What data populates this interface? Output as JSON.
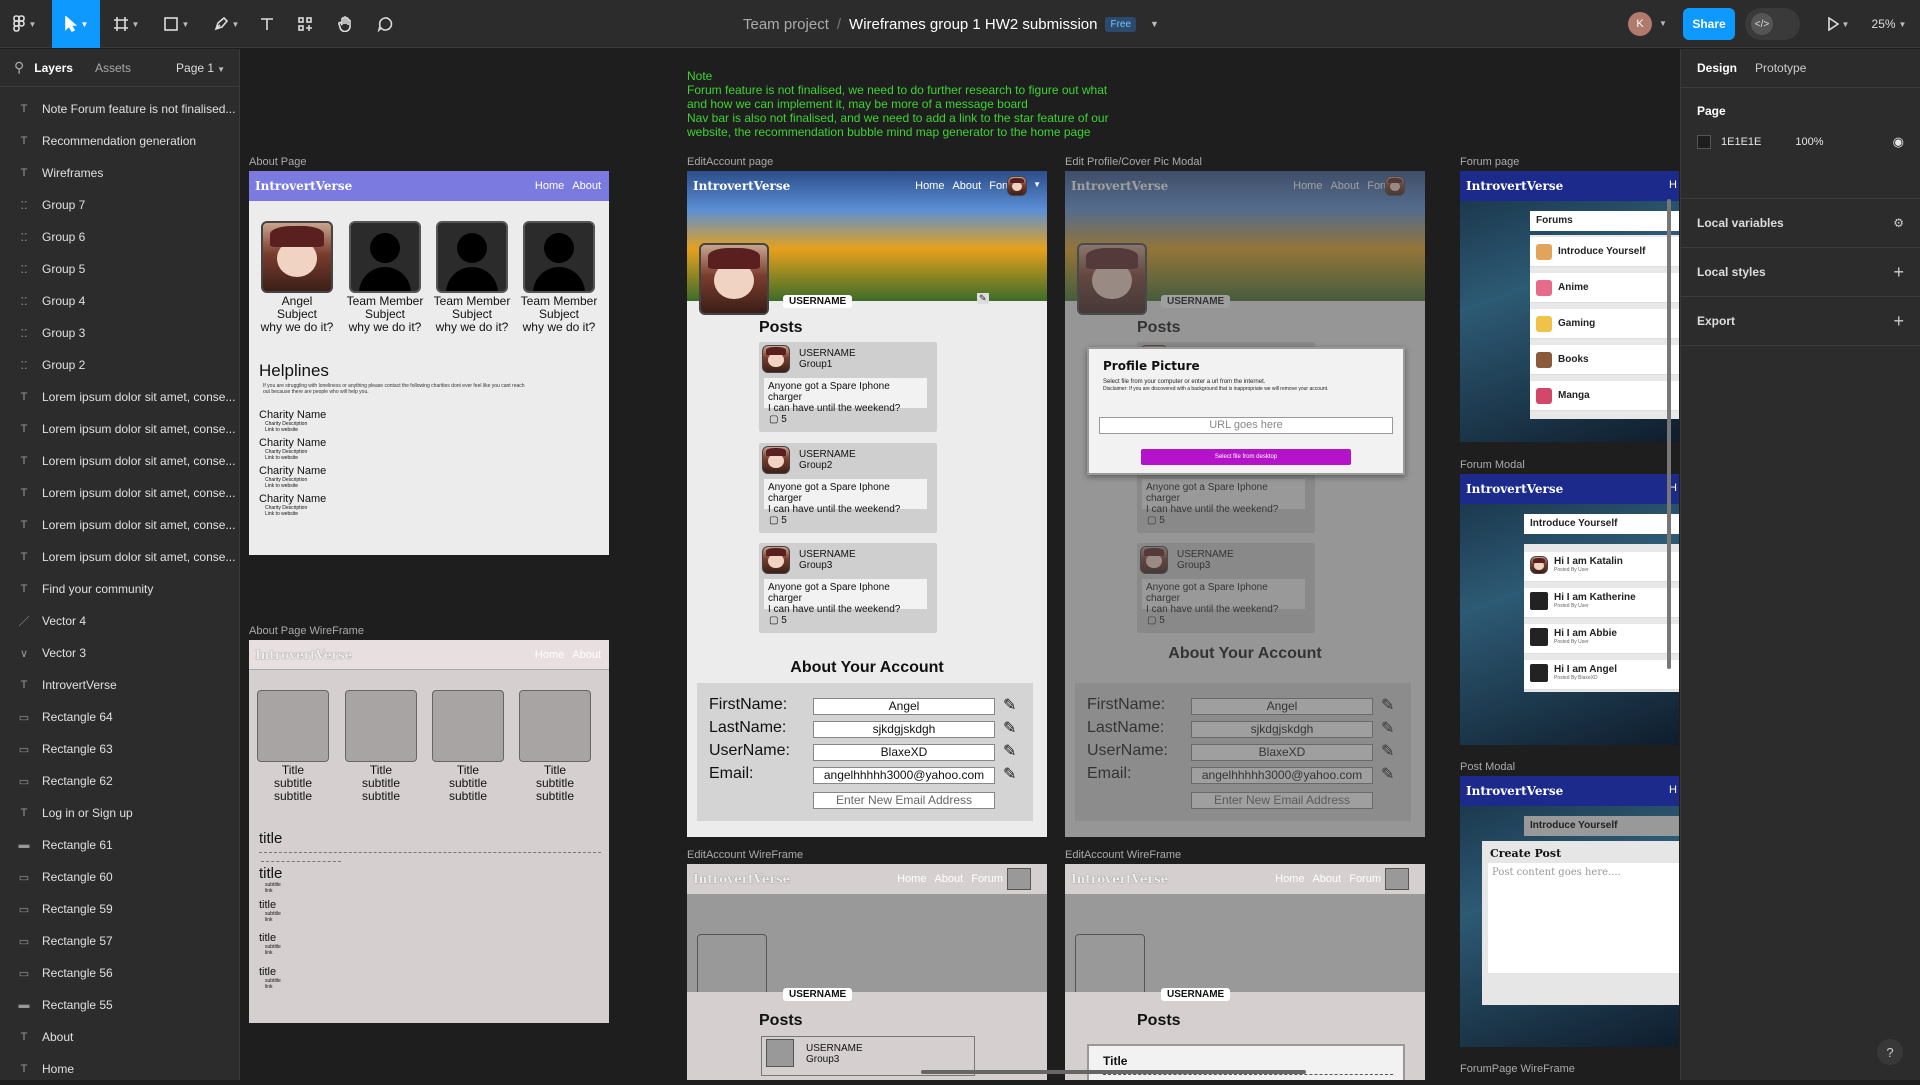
{
  "toolbar": {
    "project": "Team project",
    "separator": "/",
    "file_name": "Wireframes group 1 HW2 submission",
    "plan_badge": "Free",
    "user_initial": "K",
    "share_label": "Share",
    "zoom": "25%"
  },
  "left_panel": {
    "tabs": [
      "Layers",
      "Assets"
    ],
    "page_selector": "Page 1",
    "layers": [
      {
        "type": "text",
        "name": "Note Forum feature is not finalised..."
      },
      {
        "type": "text",
        "name": "Recommendation generation"
      },
      {
        "type": "text",
        "name": "Wireframes"
      },
      {
        "type": "group",
        "name": "Group 7"
      },
      {
        "type": "group",
        "name": "Group 6"
      },
      {
        "type": "group",
        "name": "Group 5"
      },
      {
        "type": "group",
        "name": "Group 4"
      },
      {
        "type": "group",
        "name": "Group 3"
      },
      {
        "type": "group",
        "name": "Group 2"
      },
      {
        "type": "text",
        "name": "Lorem ipsum dolor sit amet, conse..."
      },
      {
        "type": "text",
        "name": "Lorem ipsum dolor sit amet, conse..."
      },
      {
        "type": "text",
        "name": "Lorem ipsum dolor sit amet, conse..."
      },
      {
        "type": "text",
        "name": "Lorem ipsum dolor sit amet, conse..."
      },
      {
        "type": "text",
        "name": "Lorem ipsum dolor sit amet, conse..."
      },
      {
        "type": "text",
        "name": "Lorem ipsum dolor sit amet, conse..."
      },
      {
        "type": "text",
        "name": "Find your community"
      },
      {
        "type": "vector",
        "name": "Vector 4"
      },
      {
        "type": "vector",
        "name": "Vector 3"
      },
      {
        "type": "text",
        "name": "IntrovertVerse"
      },
      {
        "type": "rect",
        "name": "Rectangle 64"
      },
      {
        "type": "rect",
        "name": "Rectangle 63"
      },
      {
        "type": "rect",
        "name": "Rectangle 62"
      },
      {
        "type": "text",
        "name": "Log in or Sign up"
      },
      {
        "type": "line",
        "name": "Rectangle 61"
      },
      {
        "type": "rect",
        "name": "Rectangle 60"
      },
      {
        "type": "rect",
        "name": "Rectangle 59"
      },
      {
        "type": "rect",
        "name": "Rectangle 57"
      },
      {
        "type": "rect",
        "name": "Rectangle 56"
      },
      {
        "type": "line",
        "name": "Rectangle 55"
      },
      {
        "type": "text",
        "name": "About"
      },
      {
        "type": "text",
        "name": "Home"
      }
    ]
  },
  "right_panel": {
    "tabs": [
      "Design",
      "Prototype"
    ],
    "page_section": "Page",
    "page_color": "1E1E1E",
    "page_opacity": "100%",
    "local_variables": "Local variables",
    "local_styles": "Local styles",
    "export": "Export",
    "help": "?"
  },
  "canvas": {
    "note": {
      "title": "Note",
      "line1": "Forum feature is not finalised, we need to do further research to figure out what",
      "line2": "and how we can implement it, may be more of a message board",
      "line3": "Nav bar is also not finalised, and we need to add a link to the star feature of our",
      "line4": "website, the recommendation bubble mind map generator to the home page"
    },
    "frame_labels": {
      "about": "About Page",
      "edit_account": "EditAccount page",
      "edit_profile": "Edit Profile/Cover Pic Modal",
      "forum": "Forum page",
      "about_wire": "About Page WireFrame",
      "forum_modal": "Forum Modal",
      "post_modal": "Post Modal",
      "edit_wire1": "EditAccount WireFrame",
      "edit_wire2": "EditAccount WireFrame",
      "forum_wire": "ForumPage WireFrame"
    },
    "brand": "IntrovertVerse",
    "nav": {
      "home": "Home",
      "about": "About",
      "forum": "Forum"
    },
    "about_page": {
      "members": [
        {
          "name": "Angel",
          "subject": "Subject",
          "why": "why we do it?"
        },
        {
          "name": "Team Member",
          "subject": "Subject",
          "why": "why we do it?"
        },
        {
          "name": "Team Member",
          "subject": "Subject",
          "why": "why we do it?"
        },
        {
          "name": "Team Member",
          "subject": "Subject",
          "why": "why we do it?"
        }
      ],
      "helplines_title": "Helplines",
      "helplines_text1": "If you are struggling with loneliness or anything please contact the following charities dont ever feel like you cant reach",
      "helplines_text2": "out because there are people who will help you.",
      "charities": [
        {
          "name": "Charity Name",
          "desc": "Charity Description",
          "link": "Link to website"
        },
        {
          "name": "Charity Name",
          "desc": "Charity Description",
          "link": "Link to website"
        },
        {
          "name": "Charity Name",
          "desc": "Charity Description",
          "link": "Link to website"
        },
        {
          "name": "Charity Name",
          "desc": "Charity Description",
          "link": "Link to website"
        }
      ]
    },
    "about_wire": {
      "cards": [
        {
          "title": "Title",
          "s1": "subtitle",
          "s2": "subtitle"
        },
        {
          "title": "Title",
          "s1": "subtitle",
          "s2": "subtitle"
        },
        {
          "title": "Title",
          "s1": "subtitle",
          "s2": "subtitle"
        },
        {
          "title": "Title",
          "s1": "subtitle",
          "s2": "subtitle"
        }
      ],
      "heading": "title",
      "items": [
        {
          "title": "title",
          "sub": "subtitle",
          "link": "link"
        },
        {
          "title": "title",
          "sub": "subtitle",
          "link": "link"
        },
        {
          "title": "title",
          "sub": "subtitle",
          "link": "link"
        },
        {
          "title": "title",
          "sub": "subtitle",
          "link": "link"
        }
      ]
    },
    "edit_account": {
      "username_tag": "USERNAME",
      "posts_title": "Posts",
      "posts": [
        {
          "user": "USERNAME",
          "group": "Group1",
          "body1": "Anyone got a Spare Iphone charger",
          "body2": "I can have until the weekend?",
          "comments": "5"
        },
        {
          "user": "USERNAME",
          "group": "Group2",
          "body1": "Anyone got a Spare Iphone charger",
          "body2": "I can have until the weekend?",
          "comments": "5"
        },
        {
          "user": "USERNAME",
          "group": "Group3",
          "body1": "Anyone got a Spare Iphone charger",
          "body2": "I can have until the weekend?",
          "comments": "5"
        }
      ],
      "about_title": "About Your Account",
      "fields": [
        {
          "label": "FirstName:",
          "value": "Angel"
        },
        {
          "label": "LastName:",
          "value": "sjkdgjskdgh"
        },
        {
          "label": "UserName:",
          "value": "BlaxeXD"
        },
        {
          "label": "Email:",
          "value": "angelhhhhh3000@yahoo.com"
        }
      ],
      "new_email_placeholder": "Enter New Email Address"
    },
    "profile_modal": {
      "title": "Profile Picture",
      "desc": "Select file from your computer or enter a url from the internet.",
      "disclaimer": "Disclaimer: If you are discovered with a background that is inappropriate we will remove your account.",
      "url_placeholder": "URL goes here",
      "select_button": "Select file from desktop"
    },
    "forum_page": {
      "header": "Forums",
      "items": [
        "Introduce Yourself",
        "Anime",
        "Gaming",
        "Books",
        "Manga"
      ]
    },
    "forum_modal": {
      "header": "Introduce Yourself",
      "threads": [
        {
          "title": "Hi I am Katalin",
          "by": "Posted By User"
        },
        {
          "title": "Hi I am Katherine",
          "by": "Posted By User"
        },
        {
          "title": "Hi I am Abbie",
          "by": "Posted By User"
        },
        {
          "title": "Hi I am Angel",
          "by": "Posted By BlaxeXD"
        }
      ]
    },
    "post_modal": {
      "header": "Introduce Yourself",
      "title": "Create Post",
      "placeholder": "Post content goes here...."
    },
    "edit_wire": {
      "username_tag": "USERNAME",
      "posts_title": "Posts",
      "post_user": "USERNAME",
      "post_group": "Group3",
      "modal_title": "Title"
    }
  }
}
